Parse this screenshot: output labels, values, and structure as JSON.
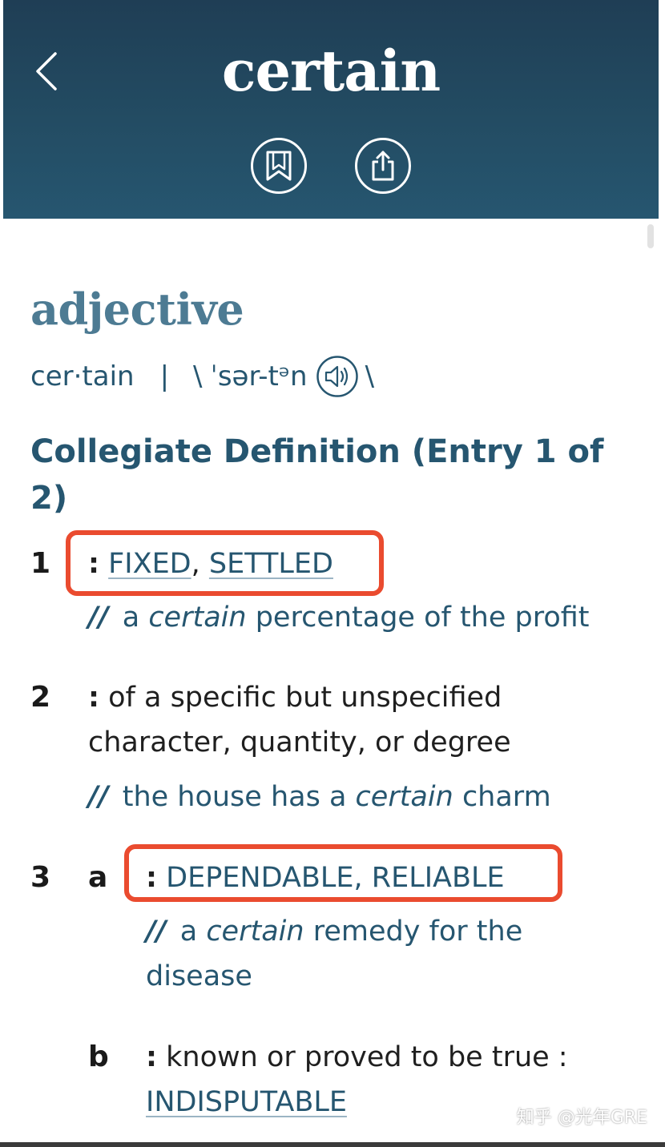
{
  "header": {
    "title": "certain",
    "back_icon": "chevron-left-icon",
    "bookmark_icon": "bookmark-icon",
    "share_icon": "share-icon",
    "bg_color": "#234c63"
  },
  "entry": {
    "part_of_speech": "adjective",
    "syllables": "cer·tain",
    "separator": "|",
    "pron_open": "\\",
    "pronunciation": "ˈsər-tᵊn",
    "pron_close": "\\",
    "sound_icon": "speaker-icon",
    "heading": "Collegiate Definition (Entry 1 of 2)"
  },
  "senses": [
    {
      "number": "1",
      "colon": ":",
      "link1": "FIXED",
      "comma": ",",
      "link2": "SETTLED",
      "example": {
        "slashes": "//",
        "pre": "a",
        "em": "certain",
        "post": "percentage of the profit"
      }
    },
    {
      "number": "2",
      "colon": ":",
      "text": "of a specific but unspecified character, quantity, or degree",
      "example": {
        "slashes": "//",
        "pre": "the house has a",
        "em": "certain",
        "post": "charm"
      }
    },
    {
      "number": "3",
      "letter": "a",
      "colon": ":",
      "link1": "DEPENDABLE",
      "comma": ",",
      "link2": "RELIABLE",
      "example": {
        "slashes": "//",
        "pre": "a",
        "em": "certain",
        "post": "remedy for the disease"
      }
    },
    {
      "letter": "b",
      "colon": ":",
      "text": "known or proved to be true :",
      "link1": "INDISPUTABLE"
    }
  ],
  "colors": {
    "accent": "#265670",
    "pos": "#4d7b93",
    "highlight": "#ea4b2f"
  },
  "watermark": "知乎 @光年GRE"
}
